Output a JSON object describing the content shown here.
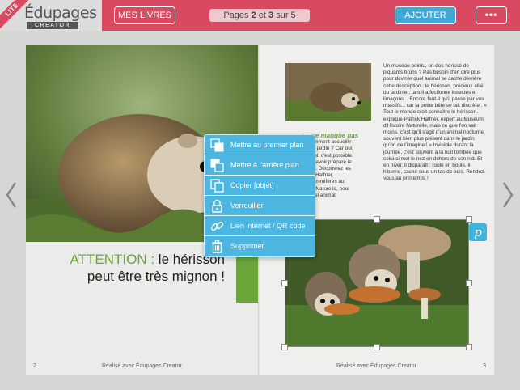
{
  "header": {
    "lite_label": "LITE",
    "logo_text": "Édupages",
    "logo_sub": "CREATOR",
    "books_button": "MES LIVRES",
    "pages_prefix": "Pages ",
    "page_a": "2",
    "pages_and": " et ",
    "page_b": "3",
    "pages_suffix": " sur 5",
    "add_button": "AJOUTER",
    "more_button": "•••"
  },
  "left_page": {
    "attention_word": "ATTENTION :",
    "attention_rest": " le hérisson peut être très mignon !",
    "page_number": "2",
    "footer": "Réalisé avec Édupages Creator"
  },
  "right_page": {
    "left_column_title": "on ne manque pas",
    "left_column_lines": [
      "t : Comment accueillir",
      "ans le jardin ? Car oui,",
      "nez sol, c'est possible.",
      "faut-il avoir préparé le",
      "alable. Découvrez les",
      "atrick Haffner,",
      "es mammifères au",
      "stoire Naturelle, pour",
      "r ce bel animal."
    ],
    "right_column_text": "Un museau pointu, un dos hérissé de piquants bruns ? Pas besoin d'en dire plus pour deviner quel animal se cache derrière cette description : le hérisson, précieux allié du jardinier, tant il affectionne insectes et limaçons... Encore faut-il qu'il passe par vos massifs... car la petite bête se fait discrète : « Tout le monde croit connaître le hérisson, explique Patrick Haffner, expert au Muséum d'Histoire Naturelle, mais ce que l'on sait moins, c'est qu'il s'agit d'un animal nocturne, souvent bien plus présent dans le jardin qu'on ne l'imagine ! » Invisible durant la journée, c'est souvent à la nuit tombée que celui-ci met le nez en dehors de son nid. Et en hiver, il disparaît : roulé en boule, il hiberne, caché sous un tas de bois. Rendez-vous au printemps !",
    "page_number": "3",
    "footer": "Réalisé avec Édupages Creator",
    "badge": "p"
  },
  "context_menu": {
    "items": [
      {
        "label": "Mettre au premier plan",
        "icon": "bring-to-front-icon"
      },
      {
        "label": "Mettre à l'arrière plan",
        "icon": "send-to-back-icon"
      },
      {
        "label": "Copier [objet]",
        "icon": "copy-icon"
      },
      {
        "label": "Verrouiller",
        "icon": "lock-icon"
      },
      {
        "label": "Lien internet / QR code",
        "icon": "link-icon"
      },
      {
        "label": "Supprimer",
        "icon": "trash-icon"
      }
    ]
  },
  "colors": {
    "header_bg": "#d94a62",
    "accent_blue": "#3fa8d4",
    "menu_bg": "#4db6e0",
    "accent_green": "#6aa53a"
  }
}
